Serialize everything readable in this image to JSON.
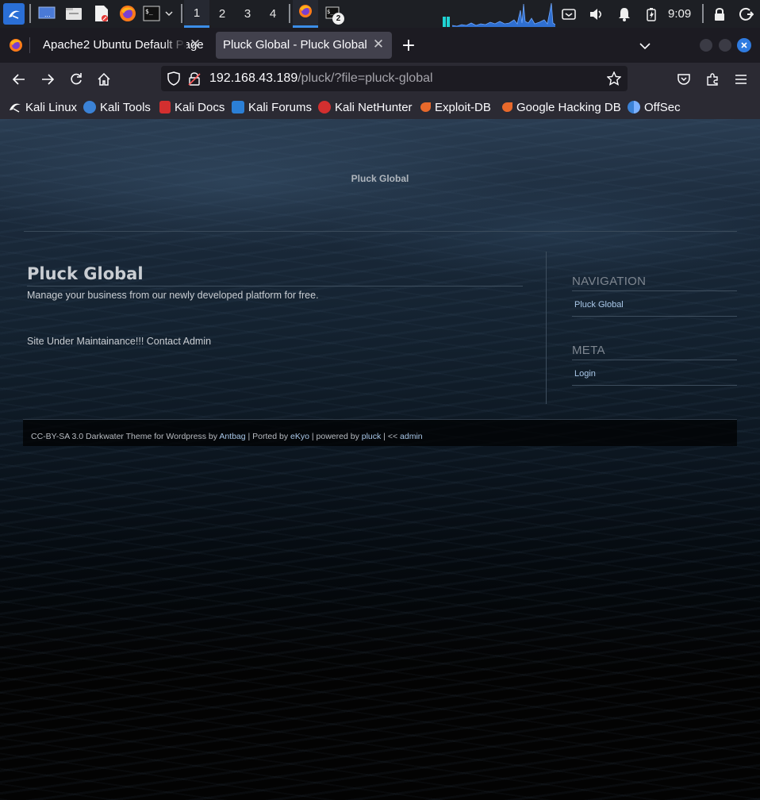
{
  "taskbar": {
    "workspaces": [
      "1",
      "2",
      "3",
      "4"
    ],
    "active_workspace": "1",
    "terminal_badge": "2",
    "clock": "9:09",
    "icons": [
      "kali-menu-icon",
      "show-desktop-icon",
      "file-manager-icon",
      "text-editor-icon",
      "firefox-icon",
      "terminal-icon",
      "chevron-down-icon",
      "firefox-window-icon",
      "terminal-window-icon",
      "network-icon",
      "volume-icon",
      "notification-bell-icon",
      "battery-icon",
      "lock-icon",
      "power-icon"
    ]
  },
  "browser": {
    "tabs": [
      {
        "title": "Apache2 Ubuntu Default Page",
        "active": false
      },
      {
        "title": "Pluck Global - Pluck Global",
        "active": true
      }
    ],
    "new_tab_label": "+",
    "url_host": "192.168.43.189",
    "url_path": "/pluck/?file=pluck-global",
    "bookmarks": [
      {
        "label": "Kali Linux",
        "icon": "kali-dragon-icon",
        "color": "#ffffff"
      },
      {
        "label": "Kali Tools",
        "icon": "kali-tools-icon",
        "color": "#3b82d6"
      },
      {
        "label": "Kali Docs",
        "icon": "kali-docs-icon",
        "color": "#d32f2f"
      },
      {
        "label": "Kali Forums",
        "icon": "kali-forums-icon",
        "color": "#2b7fd6"
      },
      {
        "label": "Kali NetHunter",
        "icon": "nethunter-icon",
        "color": "#d32f2f"
      },
      {
        "label": "Exploit-DB",
        "icon": "exploit-db-icon",
        "color": "#e8692b"
      },
      {
        "label": "Google Hacking DB",
        "icon": "ghdb-icon",
        "color": "#e8692b"
      },
      {
        "label": "OffSec",
        "icon": "offsec-icon",
        "color": "#3b82d6"
      }
    ],
    "accent": "#3b8ee8"
  },
  "site": {
    "header_title": "Pluck Global",
    "post_title": "Pluck Global",
    "post_subtitle": "Manage your business from our newly developed platform for free.",
    "post_body": "Site Under Maintainance!!! Contact Admin",
    "sidebar": {
      "navigation_title": "NAVIGATION",
      "navigation_items": [
        "Pluck Global"
      ],
      "meta_title": "META",
      "meta_items": [
        "Login"
      ]
    },
    "footer": {
      "prefix": "CC-BY-SA 3.0 Darkwater Theme for Wordpress by ",
      "antbag": "Antbag",
      "ported": " | Ported by ",
      "ekyo": "eKyo",
      "powered": " | powered by ",
      "pluck": "pluck",
      "sep": " | << ",
      "admin": "admin"
    }
  }
}
